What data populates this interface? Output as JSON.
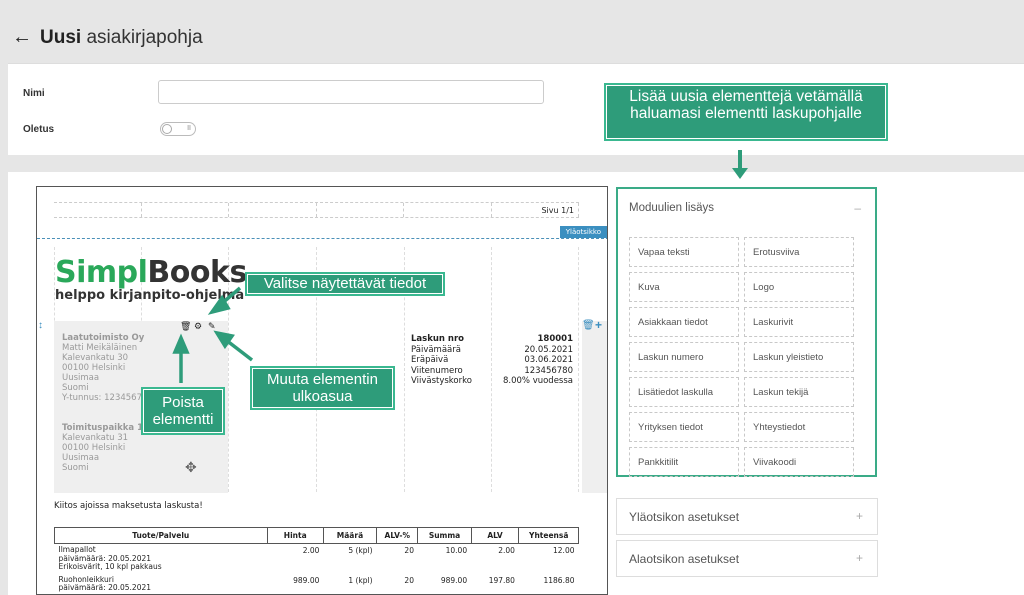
{
  "header": {
    "title_bold": "Uusi",
    "title_rest": "asiakirjapohja"
  },
  "form": {
    "name_label": "Nimi",
    "name_value": "",
    "default_label": "Oletus",
    "toggle_mark": "II"
  },
  "document": {
    "page_label": "Sivu 1/1",
    "header_tag": "Yläotsikko",
    "logo": {
      "brand_a": "Simpl",
      "brand_b": "Books",
      "tagline": "helppo kirjanpito-ohjelma"
    },
    "company": {
      "name": "Laatutoimisto Oy",
      "contact": "Matti Meikäläinen",
      "street": "Kalevankatu 30",
      "city": "00100 Helsinki",
      "region": "Uusimaa",
      "country": "Suomi",
      "business_id": "Y-tunnus: 12345678"
    },
    "office": {
      "name": "Toimituspaikka 1",
      "street": "Kalevankatu 31",
      "city": "00100 Helsinki",
      "region": "Uusimaa",
      "country": "Suomi"
    },
    "invoice": [
      {
        "label": "Laskun nro",
        "value": "180001"
      },
      {
        "label": "Päivämäärä",
        "value": "20.05.2021"
      },
      {
        "label": "Eräpäivä",
        "value": "03.06.2021"
      },
      {
        "label": "Viitenumero",
        "value": "123456780"
      },
      {
        "label": "Viivästyskorko",
        "value": "8.00% vuodessa"
      }
    ],
    "thanks": "Kiitos ajoissa maksetusta laskusta!",
    "columns": [
      "Tuote/Palvelu",
      "Hinta",
      "Määrä",
      "ALV-%",
      "Summa",
      "ALV",
      "Yhteensä"
    ],
    "rows": [
      {
        "name": "Ilmapallot",
        "sub1": "päivämäärä: 20.05.2021",
        "sub2": "Erikoisvärit, 10 kpl pakkaus",
        "price": "2.00",
        "qty": "5 (kpl)",
        "vat_pct": "20",
        "sum": "10.00",
        "vat": "2.00",
        "total": "12.00"
      },
      {
        "name": "Ruohonleikkuri",
        "sub1": "päivämäärä: 20.05.2021",
        "sub2": "",
        "price": "989.00",
        "qty": "1 (kpl)",
        "vat_pct": "20",
        "sum": "989.00",
        "vat": "197.80",
        "total": "1186.80"
      }
    ]
  },
  "modules": {
    "title": "Moduulien lisäys",
    "items": [
      "Vapaa teksti",
      "Erotusviiva",
      "Kuva",
      "Logo",
      "Asiakkaan tiedot",
      "Laskurivit",
      "Laskun numero",
      "Laskun yleistieto",
      "Lisätiedot laskulla",
      "Laskun tekijä",
      "Yrityksen tiedot",
      "Yhteystiedot",
      "Pankkitilit",
      "Viivakoodi"
    ]
  },
  "accordions": [
    "Yläotsikon asetukset",
    "Alaotsikon asetukset"
  ],
  "callouts": {
    "add": "Lisää uusia elementtejä vetämällä haluamasi elementti laskupohjalle",
    "choose": "Valitse näytettävät tiedot",
    "style": "Muuta elementin ulkoasua",
    "delete": "Poista elementti"
  },
  "colors": {
    "accent": "#2e9c7a",
    "brand_green": "#2aa85a",
    "link_blue": "#3b8fc0"
  }
}
